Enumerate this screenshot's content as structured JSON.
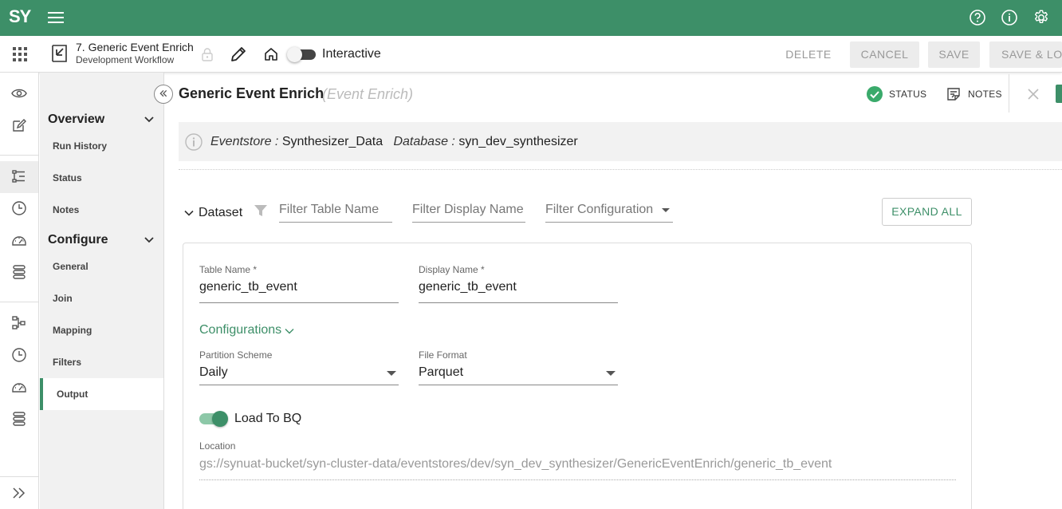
{
  "app": {
    "logo": "SY"
  },
  "toolbar": {
    "workflow_title": "7. Generic Event Enrich",
    "workflow_subtitle": "Development Workflow",
    "interactive_label": "Interactive",
    "delete_label": "DELETE",
    "cancel_label": "CANCEL",
    "save_label": "SAVE",
    "save_lock_label": "SAVE & LOCK"
  },
  "sidenav": {
    "overview": "Overview",
    "overview_items": [
      "Run History",
      "Status",
      "Notes"
    ],
    "configure": "Configure",
    "configure_items": [
      "General",
      "Join",
      "Mapping",
      "Filters",
      "Output"
    ],
    "active_item": "Output"
  },
  "header": {
    "title": "Generic Event Enrich",
    "subtitle": "(Event Enrich)",
    "status_label": "STATUS",
    "notes_label": "NOTES"
  },
  "info": {
    "eventstore_label": "Eventstore :",
    "eventstore_value": "Synthesizer_Data",
    "database_label": "Database :",
    "database_value": "syn_dev_synthesizer"
  },
  "dataset": {
    "label": "Dataset",
    "filter_table_placeholder": "Filter Table Name",
    "filter_display_placeholder": "Filter Display Name",
    "filter_config_placeholder": "Filter Configuration",
    "expand_all_label": "EXPAND ALL"
  },
  "card": {
    "table_name_label": "Table Name *",
    "table_name_value": "generic_tb_event",
    "display_name_label": "Display Name *",
    "display_name_value": "generic_tb_event",
    "configurations_label": "Configurations",
    "partition_label": "Partition Scheme",
    "partition_value": "Daily",
    "file_format_label": "File Format",
    "file_format_value": "Parquet",
    "load_to_bq_label": "Load To BQ",
    "load_to_bq_on": true,
    "location_label": "Location",
    "location_value": "gs://synuat-bucket/syn-cluster-data/eventstores/dev/syn_dev_synthesizer/GenericEventEnrich/generic_tb_event"
  },
  "colors": {
    "brand": "#3d8f68",
    "status_ok": "#3aaa6b"
  },
  "icons": [
    "hamburger-icon",
    "help-icon",
    "info-icon",
    "gear-icon",
    "apps-icon",
    "back-icon",
    "lock-icon",
    "pencil-icon",
    "home-icon",
    "eye-icon",
    "edit-icon",
    "flow-icon",
    "clock-icon",
    "dashboard-icon",
    "database-icon",
    "filter-icon",
    "close-icon",
    "notes-icon",
    "check-circle-icon"
  ]
}
